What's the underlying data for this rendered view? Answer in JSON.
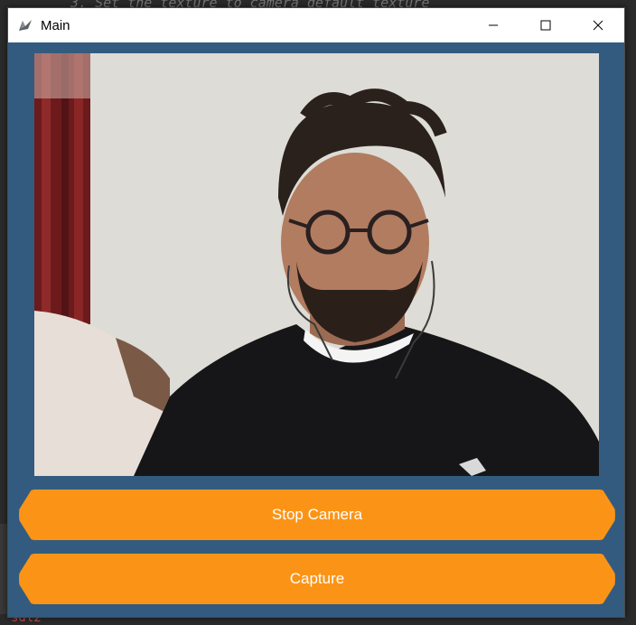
{
  "background": {
    "code_line": "3. Set the texture to camera default texture",
    "bottom_text": "sdl2"
  },
  "window": {
    "title": "Main",
    "icon": "kivy-logo-icon",
    "controls": [
      "minimize-icon",
      "maximize-icon",
      "close-icon"
    ]
  },
  "camera": {
    "description_icon": "camera-feed"
  },
  "buttons": {
    "stop_camera": "Stop Camera",
    "capture": "Capture"
  },
  "colors": {
    "window_bg": "#335b7f",
    "button": "#fb9416",
    "button_text": "#ffffff",
    "titlebar": "#ffffff"
  }
}
